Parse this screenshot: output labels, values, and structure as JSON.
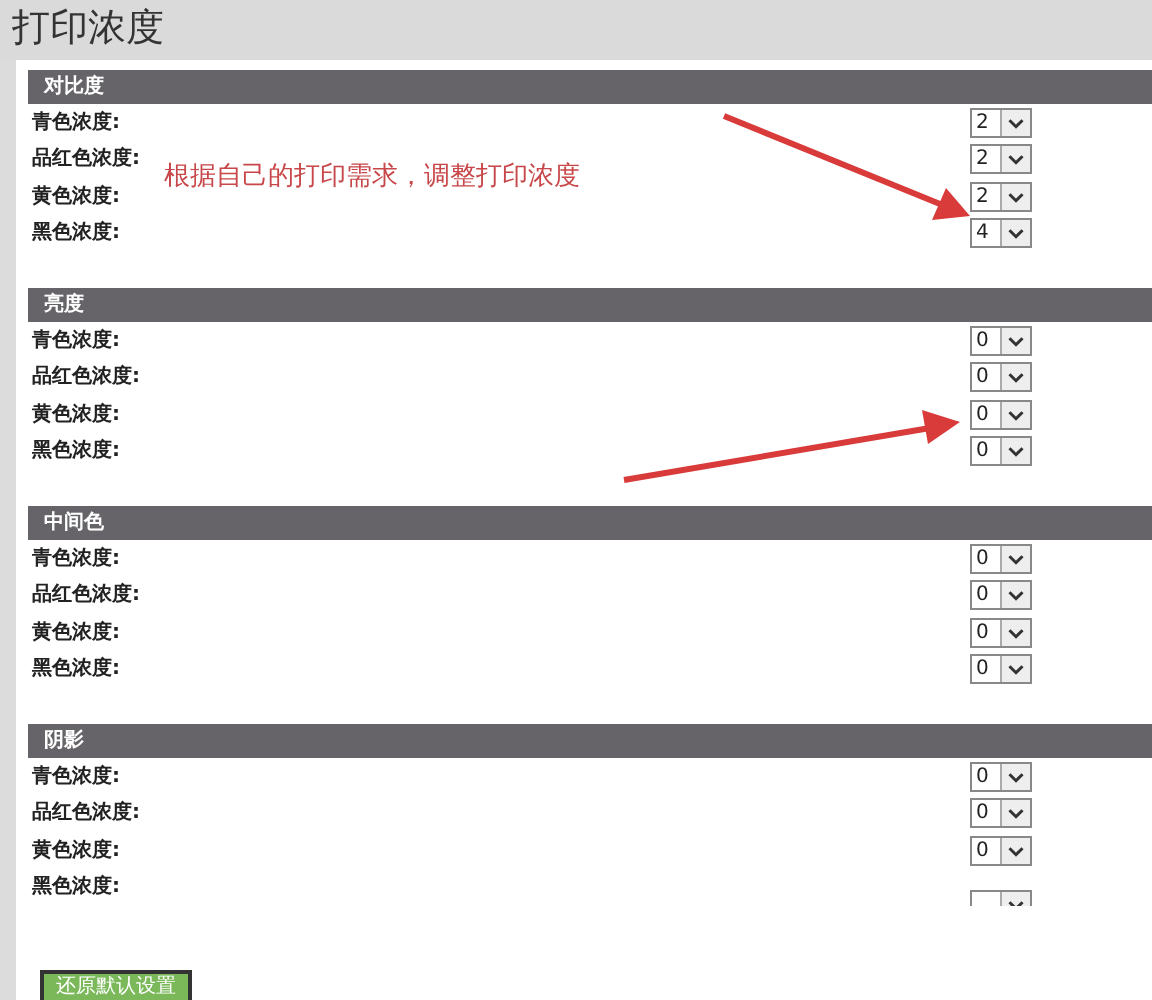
{
  "page_title": "打印浓度",
  "sections": [
    {
      "title": "对比度",
      "rows": [
        {
          "label": "青色浓度:",
          "value": "2"
        },
        {
          "label": "品红色浓度:",
          "value": "2"
        },
        {
          "label": "黄色浓度:",
          "value": "2"
        },
        {
          "label": "黑色浓度:",
          "value": "4"
        }
      ]
    },
    {
      "title": "亮度",
      "rows": [
        {
          "label": "青色浓度:",
          "value": "0"
        },
        {
          "label": "品红色浓度:",
          "value": "0"
        },
        {
          "label": "黄色浓度:",
          "value": "0"
        },
        {
          "label": "黑色浓度:",
          "value": "0"
        }
      ]
    },
    {
      "title": "中间色",
      "rows": [
        {
          "label": "青色浓度:",
          "value": "0"
        },
        {
          "label": "品红色浓度:",
          "value": "0"
        },
        {
          "label": "黄色浓度:",
          "value": "0"
        },
        {
          "label": "黑色浓度:",
          "value": "0"
        }
      ]
    },
    {
      "title": "阴影",
      "rows": [
        {
          "label": "青色浓度:",
          "value": "0"
        },
        {
          "label": "品红色浓度:",
          "value": "0"
        },
        {
          "label": "黄色浓度:",
          "value": "0"
        },
        {
          "label": "黑色浓度:"
        }
      ]
    }
  ],
  "annotation": {
    "text": "根据自己的打印需求，调整打印浓度"
  },
  "button": "还原默认设置"
}
